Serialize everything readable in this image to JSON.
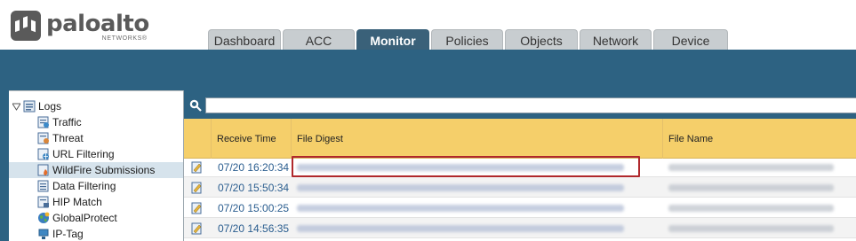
{
  "brand": {
    "name": "paloalto",
    "sub": "NETWORKS®"
  },
  "tabs": [
    {
      "label": "Dashboard",
      "active": false
    },
    {
      "label": "ACC",
      "active": false
    },
    {
      "label": "Monitor",
      "active": true
    },
    {
      "label": "Policies",
      "active": false
    },
    {
      "label": "Objects",
      "active": false
    },
    {
      "label": "Network",
      "active": false
    },
    {
      "label": "Device",
      "active": false
    }
  ],
  "nav": {
    "root": {
      "label": "Logs",
      "icon": "logs-icon"
    },
    "items": [
      {
        "label": "Traffic",
        "icon": "traffic-log-icon",
        "selected": false
      },
      {
        "label": "Threat",
        "icon": "threat-log-icon",
        "selected": false
      },
      {
        "label": "URL Filtering",
        "icon": "url-filtering-icon",
        "selected": false
      },
      {
        "label": "WildFire Submissions",
        "icon": "wildfire-icon",
        "selected": true
      },
      {
        "label": "Data Filtering",
        "icon": "data-filtering-icon",
        "selected": false
      },
      {
        "label": "HIP Match",
        "icon": "hip-match-icon",
        "selected": false
      },
      {
        "label": "GlobalProtect",
        "icon": "globalprotect-icon",
        "selected": false
      },
      {
        "label": "IP-Tag",
        "icon": "ip-tag-icon",
        "selected": false
      }
    ]
  },
  "filter": {
    "value": "",
    "placeholder": ""
  },
  "table": {
    "columns": [
      "Receive Time",
      "File Digest",
      "File Name"
    ],
    "rows": [
      {
        "receive_time": "07/20 16:20:34"
      },
      {
        "receive_time": "07/20 15:50:34"
      },
      {
        "receive_time": "07/20 15:00:25"
      },
      {
        "receive_time": "07/20 14:56:35"
      }
    ]
  },
  "colors": {
    "accent": "#2d6282",
    "active_tab": "#3a6179",
    "table_header": "#f5cf6a",
    "highlight": "#b0282c",
    "link_text": "#2a5d8f"
  }
}
